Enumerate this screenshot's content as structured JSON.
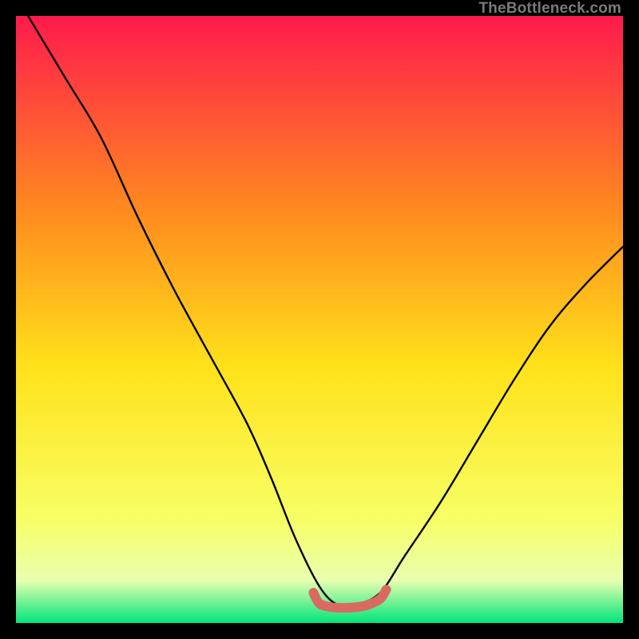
{
  "watermark": "TheBottleneck.com",
  "chart_data": {
    "type": "line",
    "title": "",
    "xlabel": "",
    "ylabel": "",
    "xlim": [
      0,
      100
    ],
    "ylim": [
      0,
      100
    ],
    "gradient_top": "#ff1a4d",
    "gradient_mid_upper": "#ff8a1f",
    "gradient_mid": "#ffe21a",
    "gradient_mid_lower": "#f7ff66",
    "gradient_bottom": "#00e57a",
    "series": [
      {
        "name": "bottleneck-curve",
        "color": "#000000",
        "x": [
          2,
          8,
          14,
          20,
          26,
          32,
          38,
          42,
          46,
          50,
          53,
          56,
          60,
          64,
          70,
          76,
          82,
          88,
          94,
          100
        ],
        "y": [
          100,
          90,
          80,
          67,
          55,
          44,
          33,
          24,
          14,
          6,
          3,
          3,
          5,
          11,
          20,
          30,
          40,
          49,
          56,
          62
        ]
      },
      {
        "name": "sweet-spot-band",
        "color": "#d86a62",
        "x": [
          49,
          50,
          52,
          54,
          56,
          58,
          60,
          61
        ],
        "y": [
          5.0,
          3.2,
          2.6,
          2.5,
          2.6,
          3.0,
          4.0,
          5.5
        ]
      }
    ],
    "annotations": []
  }
}
